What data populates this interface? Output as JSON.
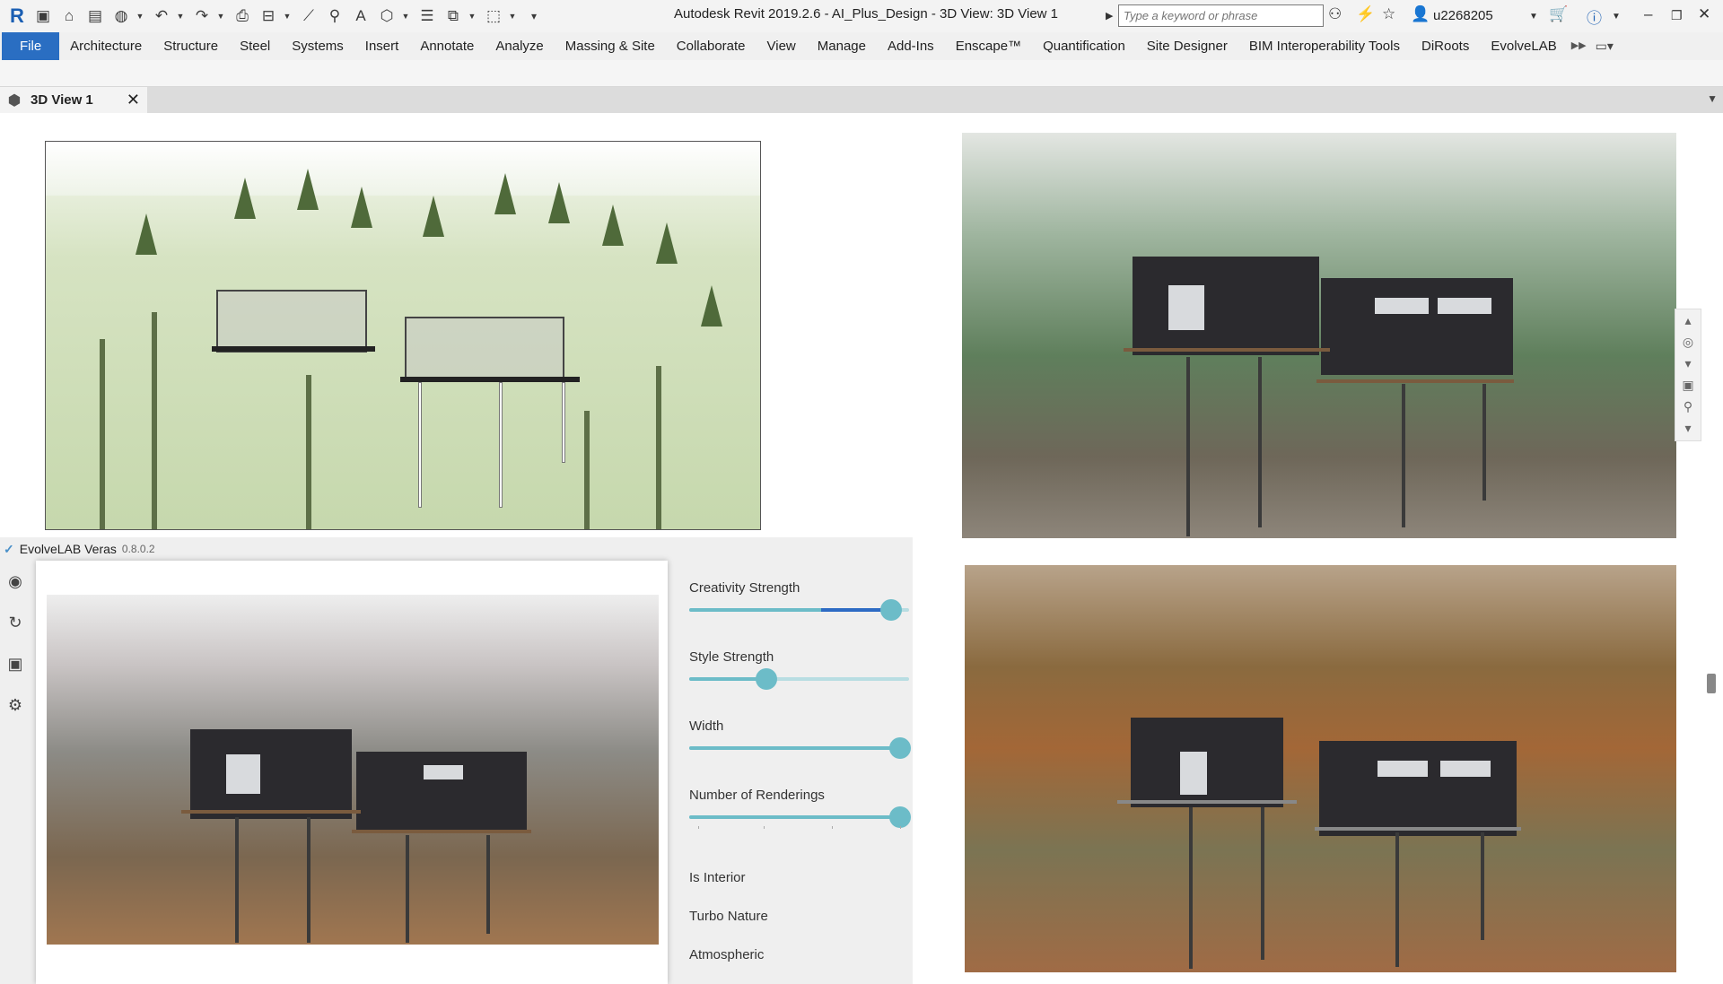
{
  "titlebar": {
    "title": "Autodesk Revit 2019.2.6 - AI_Plus_Design - 3D View: 3D View 1",
    "search_placeholder": "Type a keyword or phrase",
    "username": "u2268205"
  },
  "ribbon": {
    "tabs": [
      "File",
      "Architecture",
      "Structure",
      "Steel",
      "Systems",
      "Insert",
      "Annotate",
      "Analyze",
      "Massing & Site",
      "Collaborate",
      "View",
      "Manage",
      "Add-Ins",
      "Enscape™",
      "Quantification",
      "Site Designer",
      "BIM Interoperability Tools",
      "DiRoots",
      "EvolveLAB"
    ]
  },
  "doc_tab": {
    "label": "3D View 1"
  },
  "veras": {
    "name": "EvolveLAB Veras",
    "version": "0.8.0.2",
    "sliders": [
      {
        "label": "Creativity Strength",
        "value": 0.92,
        "accent": 0.6
      },
      {
        "label": "Style Strength",
        "value": 0.35
      },
      {
        "label": "Width",
        "value": 0.96
      },
      {
        "label": "Number of Renderings",
        "value": 0.96
      }
    ],
    "toggles": [
      "Is Interior",
      "Turbo Nature",
      "Atmospheric"
    ]
  },
  "colors": {
    "accent": "#2a6ec2",
    "slider": "#6cbcc8",
    "slider_dark": "#2d6bc4"
  }
}
